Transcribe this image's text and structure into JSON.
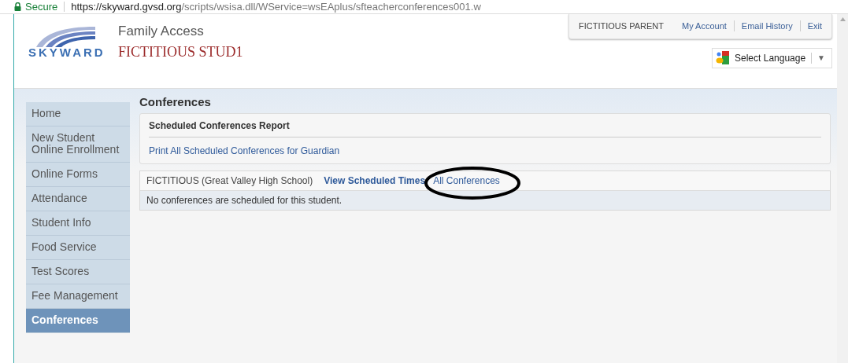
{
  "address_bar": {
    "security": "Secure",
    "url_host": "https://skyward.gvsd.org",
    "url_path": "/scripts/wsisa.dll/WService=wsEAplus/sfteacherconferences001.w"
  },
  "header": {
    "logo": "SKYWARD",
    "app_title": "Family Access",
    "student": "FICTITIOUS STUD1",
    "user": "FICTITIOUS PARENT",
    "links": [
      "My Account",
      "Email History",
      "Exit"
    ],
    "language": "Select Language",
    "language_arrow": "▼"
  },
  "sidebar": {
    "items": [
      {
        "label": "Home",
        "selected": false
      },
      {
        "label": "New Student Online Enrollment",
        "selected": false
      },
      {
        "label": "Online Forms",
        "selected": false
      },
      {
        "label": "Attendance",
        "selected": false
      },
      {
        "label": "Student Info",
        "selected": false
      },
      {
        "label": "Food Service",
        "selected": false
      },
      {
        "label": "Test Scores",
        "selected": false
      },
      {
        "label": "Fee Management",
        "selected": false
      },
      {
        "label": "Conferences",
        "selected": true
      }
    ]
  },
  "page_title": "Conferences",
  "report": {
    "title": "Scheduled Conferences Report",
    "link": "Print All Scheduled Conferences for Guardian"
  },
  "student_panel": {
    "name": "FICTITIOUS (Great Valley High School)",
    "tabs": [
      {
        "label": "View Scheduled Times",
        "selected": true
      },
      {
        "label": "All Conferences",
        "selected": false,
        "circled": true
      }
    ],
    "message": "No conferences are scheduled for this student."
  }
}
